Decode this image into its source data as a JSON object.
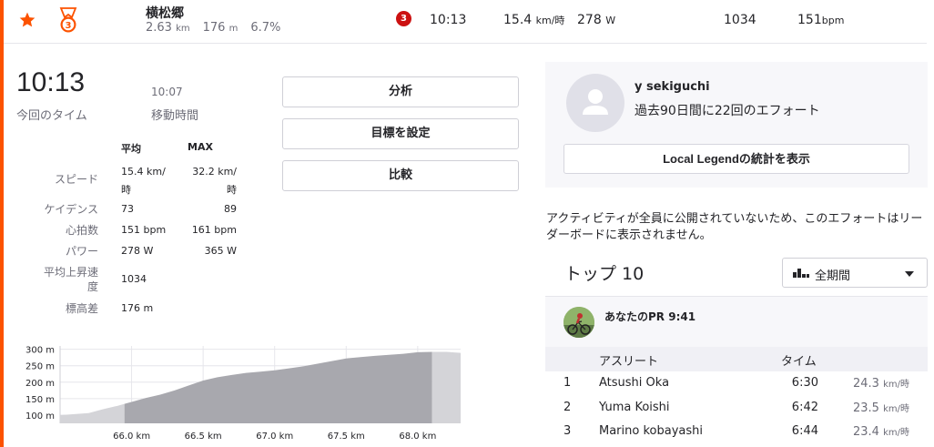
{
  "segment": {
    "name": "横松郷",
    "distance": "2.63",
    "distance_unit": "km",
    "elevation": "176",
    "elevation_unit": "m",
    "grade": "6.7%",
    "medal_number": "3",
    "rank_badge": "3",
    "time": "10:13",
    "speed": "15.4",
    "speed_unit": "km/時",
    "power": "278",
    "power_unit": "W",
    "vam": "1034",
    "heartrate": "151",
    "heartrate_unit": "bpm"
  },
  "summary": {
    "elapsed_time": "10:13",
    "elapsed_label": "今回のタイム",
    "moving_time": "10:07",
    "moving_label": "移動時間"
  },
  "stats": {
    "col_avg": "平均",
    "col_max": "MAX",
    "rows": [
      {
        "label": "スピード",
        "avg_line1": "15.4 km/",
        "avg_line2": "時",
        "max_line1": "32.2 km/",
        "max_line2": "時"
      },
      {
        "label": "ケイデンス",
        "avg": "73",
        "max": "89"
      },
      {
        "label": "心拍数",
        "avg": "151 bpm",
        "max": "161 bpm"
      },
      {
        "label": "パワー",
        "avg": "278 W",
        "max": "365 W"
      },
      {
        "label_line1": "平均上昇速",
        "label_line2": "度",
        "avg": "1034"
      },
      {
        "label": "標高差",
        "avg": "176 m"
      }
    ]
  },
  "buttons": {
    "analysis": "分析",
    "set_goal": "目標を設定",
    "compare": "比較"
  },
  "chart_data": {
    "type": "area",
    "x": [
      65.5,
      65.6,
      65.7,
      65.8,
      65.9,
      66.0,
      66.1,
      66.2,
      66.3,
      66.4,
      66.5,
      66.6,
      66.7,
      66.8,
      66.9,
      67.0,
      67.1,
      67.2,
      67.3,
      67.4,
      67.5,
      67.6,
      67.7,
      67.8,
      67.9,
      68.0,
      68.1,
      68.2,
      68.3
    ],
    "y": [
      100,
      103,
      106,
      118,
      128,
      140,
      152,
      162,
      175,
      190,
      205,
      215,
      222,
      228,
      232,
      236,
      242,
      248,
      256,
      264,
      272,
      276,
      280,
      283,
      286,
      291,
      292,
      292,
      289
    ],
    "segment_range": [
      65.95,
      68.1
    ],
    "xticks": [
      "66.0 km",
      "66.5 km",
      "67.0 km",
      "67.5 km",
      "68.0 km"
    ],
    "yticks": [
      "100 m",
      "150 m",
      "200 m",
      "250 m",
      "300 m"
    ],
    "xlim": [
      65.5,
      68.3
    ],
    "ylim": [
      75,
      310
    ],
    "grid": true,
    "colors": {
      "segment": "#a8a8ae",
      "outside": "#d4d4d8"
    }
  },
  "local_legend": {
    "name": "y sekiguchi",
    "subtitle": "過去90日間に22回のエフォート",
    "button": "Local Legendの統計を表示"
  },
  "notice": "アクティビティが全員に公開されていないため、このエフォートはリーダーボードに表示されません。",
  "leaderboard": {
    "title": "トップ 10",
    "period": "全期間",
    "pr_text": "あなたのPR 9:41",
    "col_athlete": "アスリート",
    "col_time": "タイム",
    "rows": [
      {
        "rank": "1",
        "name": "Atsushi Oka",
        "time": "6:30",
        "speed": "24.3",
        "unit": "km/時"
      },
      {
        "rank": "2",
        "name": "Yuma Koishi",
        "time": "6:42",
        "speed": "23.5",
        "unit": "km/時"
      },
      {
        "rank": "3",
        "name": "Marino kobayashi",
        "time": "6:44",
        "speed": "23.4",
        "unit": "km/時"
      }
    ]
  },
  "colors": {
    "accent": "#fc5200",
    "badge": "#cc1111",
    "panel_bg": "#f7f7fa"
  }
}
